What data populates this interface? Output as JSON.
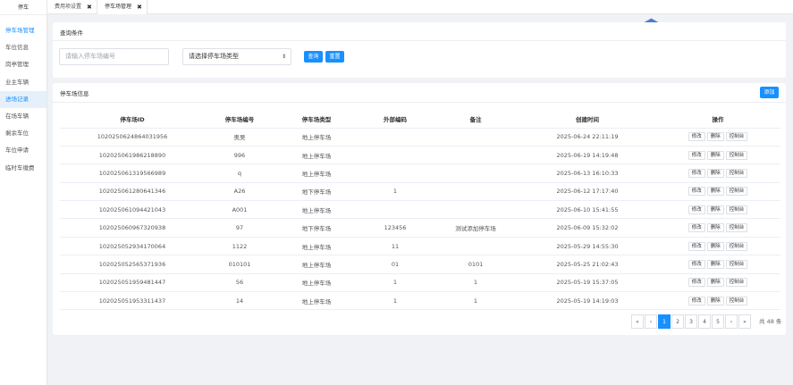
{
  "app": {
    "brand": "停车"
  },
  "sidebar": {
    "items": [
      {
        "label": "停车场管理"
      },
      {
        "label": "车位信息"
      },
      {
        "label": "岗亭管理"
      },
      {
        "label": "业主车辆"
      },
      {
        "label": "进场记录"
      },
      {
        "label": "在场车辆"
      },
      {
        "label": "剩余车位"
      },
      {
        "label": "车位申请"
      },
      {
        "label": "临时车缴费"
      }
    ]
  },
  "tabs": [
    {
      "label": "费用项设置",
      "close": "✖"
    },
    {
      "label": "停车场管理",
      "close": "✖"
    }
  ],
  "query": {
    "title": "查询条件",
    "id_placeholder": "请输入停车场编号",
    "type_select": "请选择停车场类型",
    "type_arrow": "⇕",
    "query_button": "查询",
    "reset_button": "重置"
  },
  "list": {
    "title": "停车场信息",
    "add_button": "添加",
    "columns": [
      "停车场ID",
      "停车场编号",
      "停车场类型",
      "外部编码",
      "备注",
      "创建时间",
      "操作"
    ],
    "row_actions": [
      "修改",
      "删除",
      "控制台"
    ],
    "rows": [
      {
        "id": "102025062486403195​6",
        "code": "奥吴",
        "type": "地上停车场",
        "ext": "",
        "remark": "",
        "time": "2025-06-24 22:11:19"
      },
      {
        "id": "102025061986218890",
        "code": "996",
        "type": "地上停车场",
        "ext": "",
        "remark": "",
        "time": "2025-06-19 14:19:48"
      },
      {
        "id": "102025061319566989",
        "code": "q",
        "type": "地上停车场",
        "ext": "",
        "remark": "",
        "time": "2025-06-13 16:10:33"
      },
      {
        "id": "102025061280641346",
        "code": "A26",
        "type": "地下停车场",
        "ext": "1",
        "remark": "",
        "time": "2025-06-12 17:17:40"
      },
      {
        "id": "102025061094421043",
        "code": "A001",
        "type": "地上停车场",
        "ext": "",
        "remark": "",
        "time": "2025-06-10 15:41:55"
      },
      {
        "id": "102025060967320938",
        "code": "97",
        "type": "地下停车场",
        "ext": "123456",
        "remark": "测试添加停车场",
        "time": "2025-06-09 15:32:02"
      },
      {
        "id": "102025052934170064",
        "code": "1122",
        "type": "地上停车场",
        "ext": "11",
        "remark": "",
        "time": "2025-05-29 14:55:30"
      },
      {
        "id": "102025052565371936",
        "code": "010101",
        "type": "地上停车场",
        "ext": "01",
        "remark": "0101",
        "time": "2025-05-25 21:02:43"
      },
      {
        "id": "102025051959481447",
        "code": "56",
        "type": "地上停车场",
        "ext": "1",
        "remark": "1",
        "time": "2025-05-19 15:37:05"
      },
      {
        "id": "102025051953311437",
        "code": "14",
        "type": "地上停车场",
        "ext": "1",
        "remark": "1",
        "time": "2025-05-19 14:19:03"
      }
    ]
  },
  "pagination": {
    "first": "«",
    "prev": "‹",
    "pages": [
      "1",
      "2",
      "3",
      "4",
      "5"
    ],
    "current_page": "1",
    "next": "›",
    "last": "»",
    "total_text": "共 48 条"
  },
  "colors": {
    "accent": "#1890ff",
    "logo": "#4a7fd4"
  },
  "icons": {
    "logo": "bird-logo-icon"
  }
}
